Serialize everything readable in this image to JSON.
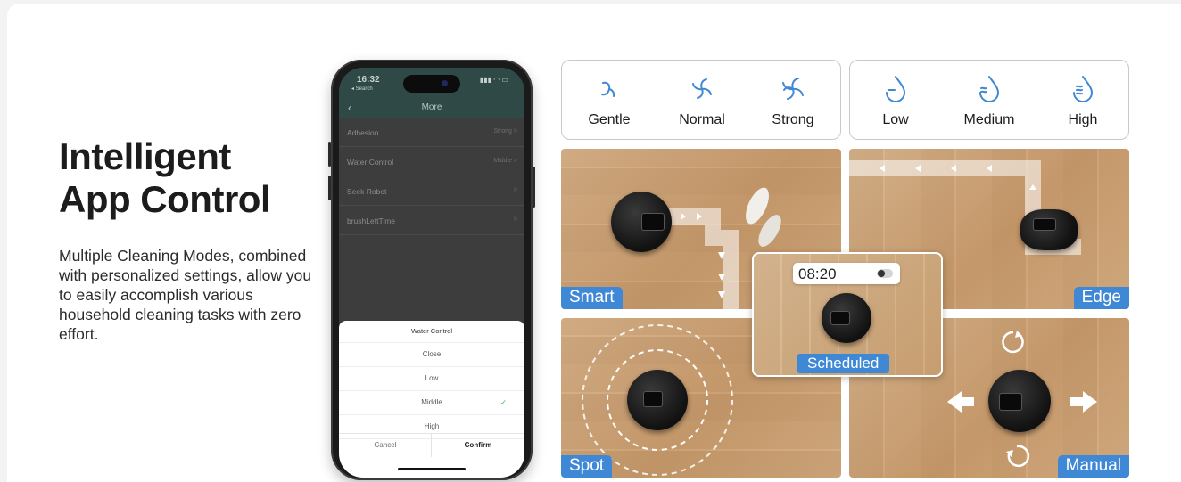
{
  "headline": {
    "line1": "Intelligent",
    "line2": "App Control"
  },
  "description": "Multiple Cleaning Modes, combined with personalized settings, allow you to easily accomplish various household cleaning tasks with zero effort.",
  "phone": {
    "status_time": "16:32",
    "status_back": "◂ Search",
    "nav_title": "More",
    "settings": [
      {
        "label": "Adhesion",
        "value": "Strong >"
      },
      {
        "label": "Water Control",
        "value": "Middle >"
      },
      {
        "label": "Seek Robot",
        "value": ">"
      },
      {
        "label": "brushLeftTime",
        "value": ">"
      }
    ],
    "sheet": {
      "title": "Water Control",
      "options": [
        "Close",
        "Low",
        "Middle",
        "High"
      ],
      "selected": "Middle",
      "cancel": "Cancel",
      "confirm": "Confirm"
    }
  },
  "suction": {
    "labels": [
      "Gentle",
      "Normal",
      "Strong"
    ],
    "icon": "fan-icon",
    "color": "#3f88d6"
  },
  "water": {
    "labels": [
      "Low",
      "Medium",
      "High"
    ],
    "icon": "water-drop-icon",
    "color": "#3f88d6"
  },
  "modes": {
    "smart": "Smart",
    "edge": "Edge",
    "spot": "Spot",
    "manual": "Manual",
    "scheduled": "Scheduled"
  },
  "schedule_time": "08:20",
  "accent_color": "#3f88d6"
}
